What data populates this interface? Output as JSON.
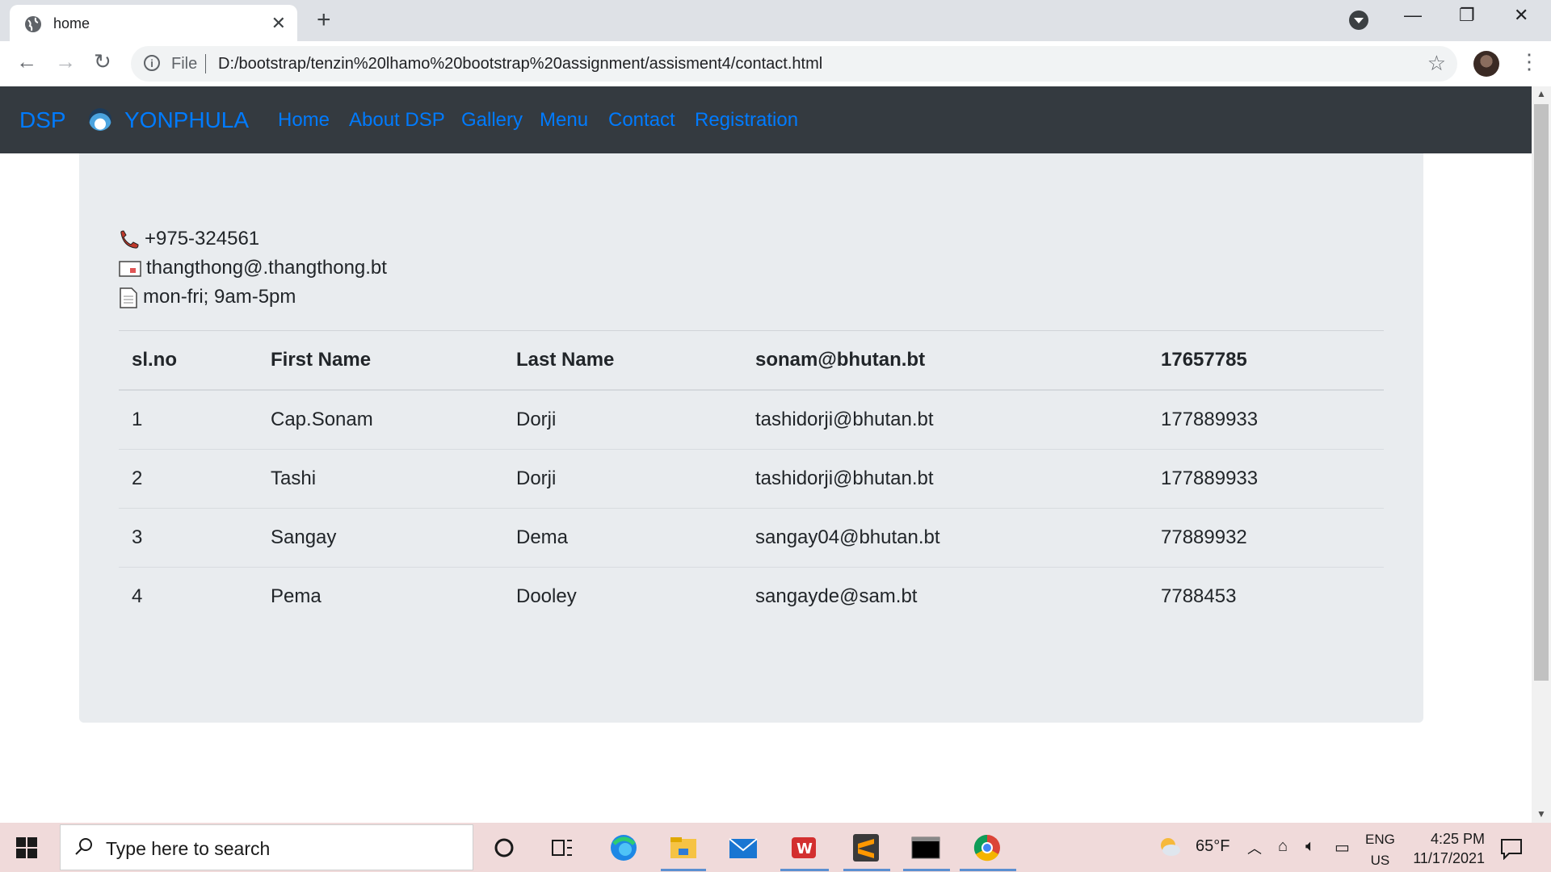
{
  "browser": {
    "tab_title": "home",
    "tab_close": "✕",
    "new_tab": "+",
    "window_controls": {
      "minimize": "—",
      "restore": "❐",
      "close": "✕"
    },
    "nav": {
      "back": "←",
      "forward": "→",
      "reload": "↻"
    },
    "address": {
      "info": "i",
      "scheme": "File",
      "url": "D:/bootstrap/tenzin%20lhamo%20bootstrap%20assignment/assisment4/contact.html",
      "bookmark": "☆"
    },
    "menu": "⋮"
  },
  "navbar": {
    "brand1": "DSP",
    "brand2": "YONPHULA",
    "links": [
      "Home",
      "About DSP",
      "Gallery",
      "Menu",
      "Contact",
      "Registration"
    ]
  },
  "contact": {
    "phone": "+975-324561",
    "email": "thangthong@.thangthong.bt",
    "hours": "mon-fri; 9am-5pm",
    "icons": [
      "phone-icon",
      "email-icon",
      "document-icon"
    ]
  },
  "table": {
    "headers": [
      "sl.no",
      "First Name",
      "Last Name",
      "sonam@bhutan.bt",
      "17657785"
    ],
    "rows": [
      [
        "1",
        "Cap.Sonam",
        "Dorji",
        "tashidorji@bhutan.bt",
        "177889933"
      ],
      [
        "2",
        "Tashi",
        "Dorji",
        "tashidorji@bhutan.bt",
        "177889933"
      ],
      [
        "3",
        "Sangay",
        "Dema",
        "sangay04@bhutan.bt",
        "77889932"
      ],
      [
        "4",
        "Pema",
        "Dooley",
        "sangayde@sam.bt",
        "7788453"
      ]
    ]
  },
  "taskbar": {
    "search_placeholder": "Type here to search",
    "weather": "65°F",
    "language": "ENG",
    "region": "US",
    "time": "4:25 PM",
    "date": "11/17/2021"
  },
  "colors": {
    "navbar_bg": "#343a40",
    "link": "#007bff",
    "jumbotron_bg": "#e9ecef",
    "taskbar_bg": "#f0dada"
  }
}
